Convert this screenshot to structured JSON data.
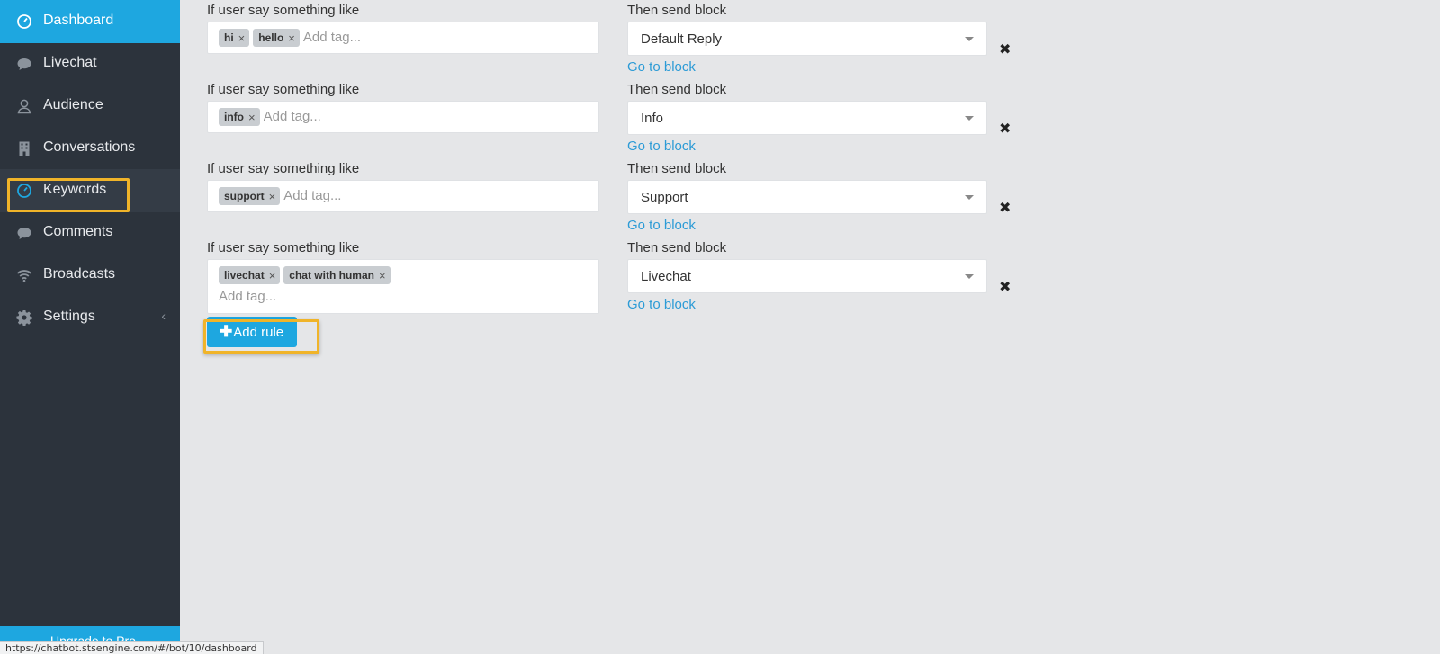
{
  "sidebar": {
    "items": [
      {
        "label": "Dashboard",
        "icon": "dashboard-icon"
      },
      {
        "label": "Livechat",
        "icon": "chat-bubble-icon"
      },
      {
        "label": "Audience",
        "icon": "user-icon"
      },
      {
        "label": "Conversations",
        "icon": "building-icon"
      },
      {
        "label": "Keywords",
        "icon": "dashboard-icon"
      },
      {
        "label": "Comments",
        "icon": "chat-bubble-icon"
      },
      {
        "label": "Broadcasts",
        "icon": "wifi-icon"
      },
      {
        "label": "Settings",
        "icon": "gear-icon"
      }
    ],
    "settings_chevron": "‹",
    "upgrade_label": "Upgrade to Pro"
  },
  "rules": [
    {
      "if_label": "If user say something like",
      "tags": [
        "hi",
        "hello"
      ],
      "tag_placeholder": "Add tag...",
      "then_label": "Then send block",
      "block": "Default Reply",
      "goto_label": "Go to block"
    },
    {
      "if_label": "If user say something like",
      "tags": [
        "info"
      ],
      "tag_placeholder": "Add tag...",
      "then_label": "Then send block",
      "block": "Info",
      "goto_label": "Go to block"
    },
    {
      "if_label": "If user say something like",
      "tags": [
        "support"
      ],
      "tag_placeholder": "Add tag...",
      "then_label": "Then send block",
      "block": "Support",
      "goto_label": "Go to block"
    },
    {
      "if_label": "If user say something like",
      "tags": [
        "livechat",
        "chat with human"
      ],
      "tag_placeholder": "Add tag...",
      "then_label": "Then send block",
      "block": "Livechat",
      "goto_label": "Go to block"
    }
  ],
  "tag_remove_glyph": "×",
  "remove_rule_glyph": "✖",
  "add_rule": {
    "plus": "✚",
    "label": "Add rule"
  },
  "status_url": "https://chatbot.stsengine.com/#/bot/10/dashboard",
  "colors": {
    "accent": "#1ea7e0",
    "sidebar": "#2c333c",
    "highlight": "#f0b429",
    "link": "#2c9bd6"
  }
}
